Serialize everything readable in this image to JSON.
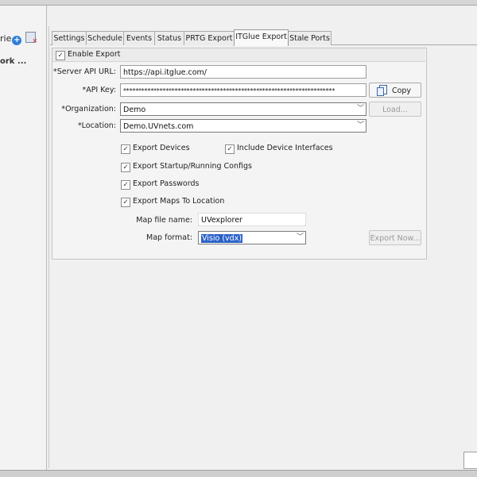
{
  "left_panel": {
    "title_partial": "rie",
    "subtitle_partial": "ork ..."
  },
  "tabs": [
    {
      "label": "Settings"
    },
    {
      "label": "Schedule"
    },
    {
      "label": "Events"
    },
    {
      "label": "Status"
    },
    {
      "label": "PRTG Export"
    },
    {
      "label": "ITGlue Export",
      "active": true
    },
    {
      "label": "Stale Ports"
    }
  ],
  "form": {
    "enable_export": {
      "label": "Enable Export",
      "checked": true
    },
    "server_api_url": {
      "label": "*Server API URL:",
      "value": "https://api.itglue.com/"
    },
    "api_key": {
      "label": "*API Key:",
      "value": "**********************************************************************"
    },
    "copy_button": {
      "label": "Copy"
    },
    "organization": {
      "label": "*Organization:",
      "value": "Demo"
    },
    "load_button": {
      "label": "Load..."
    },
    "location": {
      "label": "*Location:",
      "value": "Demo.UVnets.com"
    },
    "export_devices": {
      "label": "Export Devices",
      "checked": true
    },
    "include_device_interfaces": {
      "label": "Include Device Interfaces",
      "checked": true
    },
    "export_configs": {
      "label": "Export Startup/Running Configs",
      "checked": true
    },
    "export_passwords": {
      "label": "Export Passwords",
      "checked": true
    },
    "export_maps": {
      "label": "Export Maps To Location",
      "checked": true
    },
    "map_file_name": {
      "label": "Map file name:",
      "value": "UVexplorer"
    },
    "map_format": {
      "label": "Map format:",
      "value": "Visio (vdx)"
    },
    "export_now_button": {
      "label": "Export Now..."
    }
  },
  "icons": {
    "check": "✓",
    "chevron": "﹀",
    "plus": "+"
  },
  "colors": {
    "selection": "#2b62c9",
    "add_icon": "#2f7fd8",
    "delete_mark": "#d0302a"
  }
}
